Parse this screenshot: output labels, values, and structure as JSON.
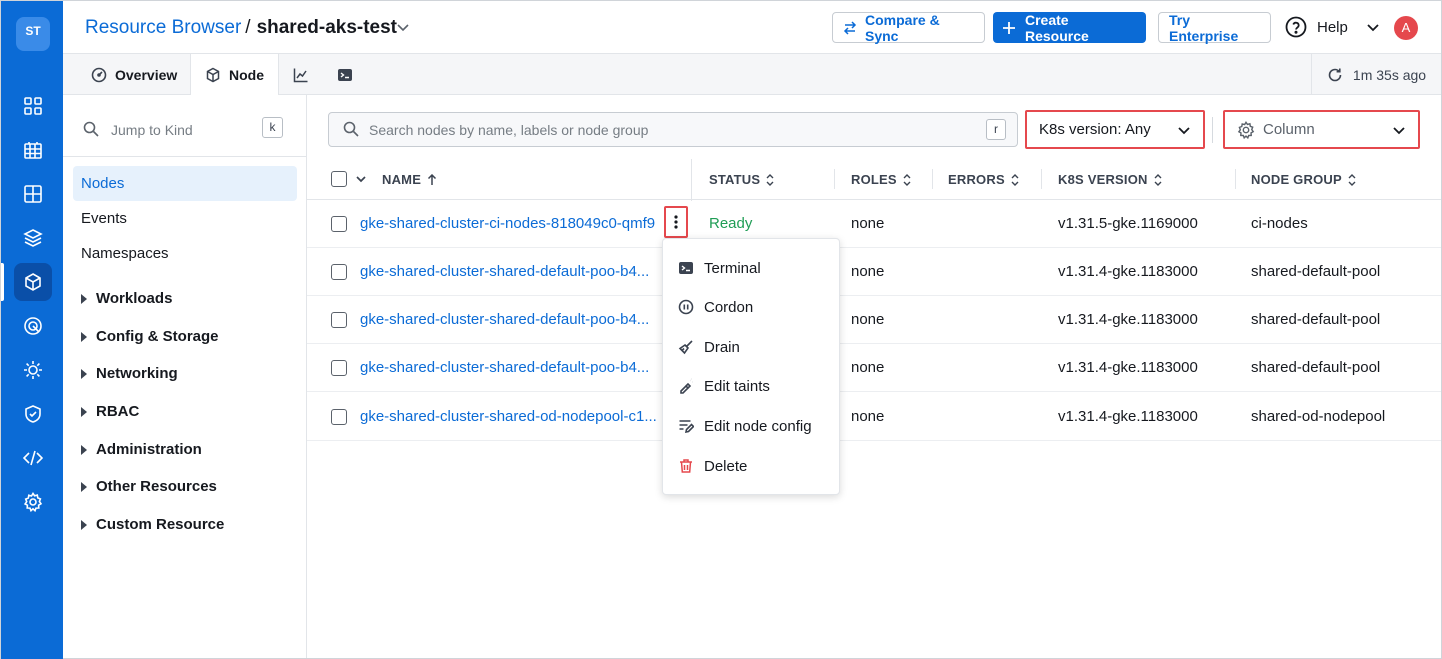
{
  "rail": {
    "logo": "ST",
    "icons": [
      "dashboard-icon",
      "apps-icon",
      "grid-icon",
      "stack-icon",
      "cube-icon",
      "target-icon",
      "bug-icon",
      "shield-icon",
      "code-icon",
      "gear-icon"
    ]
  },
  "header": {
    "breadcrumb_root": "Resource Browser",
    "breadcrumb_sep": "/",
    "cluster": "shared-aks-test",
    "compare_label": "Compare & Sync",
    "create_label": "Create Resource",
    "enterprise_label": "Try Enterprise",
    "help_label": "Help",
    "avatar_initial": "A"
  },
  "tabs": {
    "overview": "Overview",
    "node": "Node",
    "refresh_text": "1m 35s ago"
  },
  "sidebar": {
    "jump_placeholder": "Jump to Kind",
    "jump_shortcut": "k",
    "items": [
      "Nodes",
      "Events",
      "Namespaces"
    ],
    "groups": [
      "Workloads",
      "Config & Storage",
      "Networking",
      "RBAC",
      "Administration",
      "Other Resources",
      "Custom Resource"
    ]
  },
  "toolbar": {
    "search_placeholder": "Search nodes by name, labels or node group",
    "search_shortcut": "r",
    "k8s_filter": "K8s version: Any",
    "column_label": "Column"
  },
  "table": {
    "headers": {
      "name": "NAME",
      "status": "STATUS",
      "roles": "ROLES",
      "errors": "ERRORS",
      "k8s_version": "K8S VERSION",
      "node_group": "NODE GROUP"
    },
    "rows": [
      {
        "name": "gke-shared-cluster-ci-nodes-818049c0-qmf9",
        "status": "Ready",
        "roles": "none",
        "errors": "",
        "version": "v1.31.5-gke.1169000",
        "group": "ci-nodes"
      },
      {
        "name": "gke-shared-cluster-shared-default-poo-b4...",
        "status": "",
        "roles": "none",
        "errors": "",
        "version": "v1.31.4-gke.1183000",
        "group": "shared-default-pool"
      },
      {
        "name": "gke-shared-cluster-shared-default-poo-b4...",
        "status": "",
        "roles": "none",
        "errors": "",
        "version": "v1.31.4-gke.1183000",
        "group": "shared-default-pool"
      },
      {
        "name": "gke-shared-cluster-shared-default-poo-b4...",
        "status": "",
        "roles": "none",
        "errors": "",
        "version": "v1.31.4-gke.1183000",
        "group": "shared-default-pool"
      },
      {
        "name": "gke-shared-cluster-shared-od-nodepool-c1...",
        "status": "",
        "roles": "none",
        "errors": "",
        "version": "v1.31.4-gke.1183000",
        "group": "shared-od-nodepool"
      }
    ]
  },
  "context_menu": {
    "items": [
      "Terminal",
      "Cordon",
      "Drain",
      "Edit taints",
      "Edit node config",
      "Delete"
    ]
  },
  "colors": {
    "primary": "#0b6bd6",
    "ready": "#1f9d55",
    "highlight": "#e5484d",
    "danger_icon": "#e5484d"
  }
}
